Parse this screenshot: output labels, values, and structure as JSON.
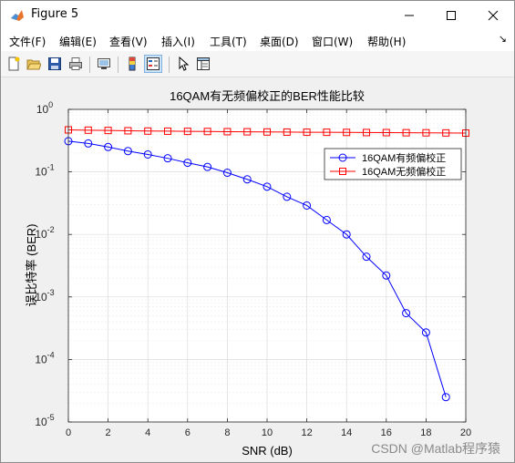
{
  "window": {
    "title": "Figure 5"
  },
  "menu": {
    "items": [
      "文件(F)",
      "编辑(E)",
      "查看(V)",
      "插入(I)",
      "工具(T)",
      "桌面(D)",
      "窗口(W)",
      "帮助(H)"
    ],
    "overflow_arrow": "↘"
  },
  "toolbar": {
    "icons": [
      "new-figure-icon",
      "open-file-icon",
      "save-icon",
      "print-icon",
      "link-icon",
      "colorbar-icon",
      "legend-icon",
      "pointer-icon",
      "property-inspector-icon"
    ]
  },
  "watermark": "CSDN @Matlab程序猿",
  "colors": {
    "series1": "#0000ff",
    "series2": "#ff0000",
    "plot_bg": "#ffffff",
    "grid": "#dcdcdc"
  },
  "chart_data": {
    "type": "line",
    "title": "16QAM有无频偏校正的BER性能比较",
    "xlabel": "SNR (dB)",
    "ylabel": "误比特率 (BER)",
    "xlim": [
      0,
      20
    ],
    "ylim": [
      1e-05,
      1
    ],
    "yscale": "log",
    "grid": true,
    "legend_position": "top-right",
    "x_ticks": [
      "0",
      "2",
      "4",
      "6",
      "8",
      "10",
      "12",
      "14",
      "16",
      "18",
      "20"
    ],
    "y_ticks": [
      {
        "base": "10",
        "exp": "0"
      },
      {
        "base": "10",
        "exp": "-1"
      },
      {
        "base": "10",
        "exp": "-2"
      },
      {
        "base": "10",
        "exp": "-3"
      },
      {
        "base": "10",
        "exp": "-4"
      },
      {
        "base": "10",
        "exp": "-5"
      }
    ],
    "series": [
      {
        "name": "16QAM有频偏校正",
        "marker": "circle",
        "x": [
          0,
          1,
          2,
          3,
          4,
          5,
          6,
          7,
          8,
          9,
          10,
          11,
          12,
          13,
          14,
          15,
          16,
          17,
          18,
          19
        ],
        "y": [
          0.31,
          0.285,
          0.25,
          0.215,
          0.19,
          0.165,
          0.14,
          0.12,
          0.097,
          0.076,
          0.058,
          0.04,
          0.029,
          0.017,
          0.01,
          0.0044,
          0.0022,
          0.00055,
          0.00027,
          2.5e-05
        ]
      },
      {
        "name": "16QAM无频偏校正",
        "marker": "square",
        "x": [
          0,
          1,
          2,
          3,
          4,
          5,
          6,
          7,
          8,
          9,
          10,
          11,
          12,
          13,
          14,
          15,
          16,
          17,
          18,
          19,
          20
        ],
        "y": [
          0.47,
          0.465,
          0.46,
          0.455,
          0.45,
          0.448,
          0.445,
          0.443,
          0.44,
          0.438,
          0.435,
          0.433,
          0.431,
          0.43,
          0.428,
          0.426,
          0.425,
          0.423,
          0.422,
          0.42,
          0.418
        ]
      }
    ]
  }
}
